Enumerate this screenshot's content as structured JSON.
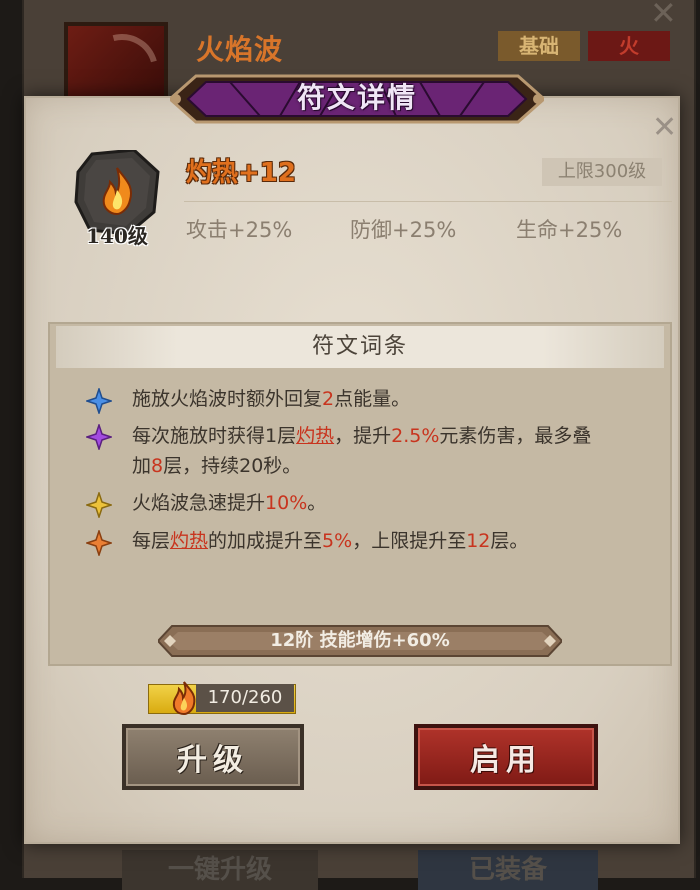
{
  "background_card": {
    "skill_name": "火焰波",
    "tag_basic": "基础",
    "tag_element": "火",
    "bottom_left": "一键升级",
    "bottom_right": "已装备"
  },
  "dialog": {
    "title": "符文详情",
    "rune": {
      "name": "灼热+12",
      "level": "140级",
      "cap": "上限300级",
      "icon": "flame-rune-icon",
      "stats": [
        "攻击+25%",
        "防御+25%",
        "生命+25%"
      ]
    },
    "affix_panel": {
      "title": "符文词条",
      "affixes": [
        {
          "star": "blue-star-icon",
          "color": "#3d7fd8",
          "segments": [
            "施放火焰波时额外回复",
            "2",
            "点能量。"
          ]
        },
        {
          "star": "purple-star-icon",
          "color": "#9b3fcf",
          "segments": [
            "每次施放时获得1层",
            "灼热",
            "，提升",
            "2.5%",
            "元素伤害，最多叠",
            "加",
            "8",
            "层，持续20秒。"
          ]
        },
        {
          "star": "yellow-star-icon",
          "color": "#e0b22a",
          "segments": [
            "火焰波急速提升",
            "10%",
            "。"
          ]
        },
        {
          "star": "orange-star-icon",
          "color": "#e0772c",
          "segments": [
            "每层",
            "灼热",
            "的加成提升至",
            "5%",
            "，上限提升至",
            "12",
            "层。"
          ]
        }
      ],
      "bonus": "12阶 技能增伤+60%"
    },
    "material": {
      "icon": "fire-essence-icon",
      "amount": "170/260",
      "current": 170,
      "required": 260
    },
    "buttons": {
      "upgrade": "升级",
      "enable": "启用"
    }
  },
  "colors": {
    "highlight": "#c8341e",
    "rune_name": "#e0701e",
    "banner": "#6a2474"
  }
}
